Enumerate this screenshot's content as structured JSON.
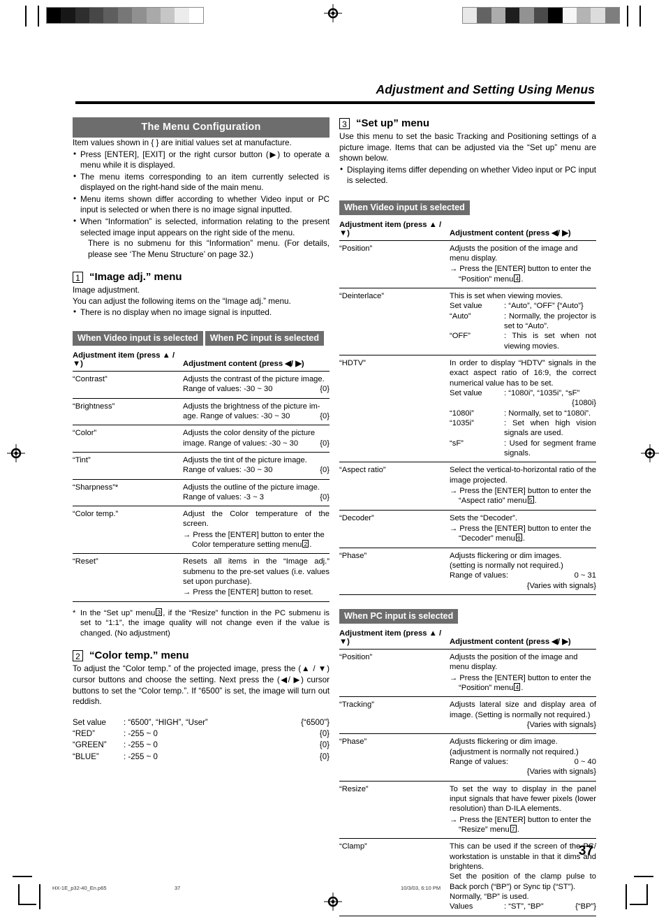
{
  "header": {
    "running_head": "Adjustment and Setting Using Menus"
  },
  "left_column": {
    "section_banner": "The Menu Configuration",
    "intro": "Item values shown in {  } are initial values set at manufacture.",
    "intro_bullets": [
      "Press [ENTER], [EXIT] or the right cursor button (▶) to operate a menu while it is displayed.",
      "The menu items corresponding to an item currently selected is displayed on the right-hand side of the main menu.",
      "Menu items shown differ according to whether Video input or PC input is selected or when there is no image signal inputted.",
      "When “Information” is selected, information relating to the present selected image input appears on the right side of the menu."
    ],
    "intro_note": "There is no submenu for this “Information” menu. (For details, please see ‘The Menu Structure’ on page 32.)",
    "menu1": {
      "number": "1",
      "title": "“Image adj.” menu",
      "line1": "Image adjustment.",
      "line2": "You can adjust the following items on the “Image adj.” menu.",
      "bullet": "There is no display when no image signal is inputted.",
      "mode_tabs": [
        "When Video input is selected",
        "When PC input is selected"
      ],
      "table_headers": {
        "item": "Adjustment item (press ▲ / ▼)",
        "content": "Adjustment content (press ◀/ ▶)"
      },
      "rows": [
        {
          "item": "“Contrast”",
          "lines": [
            "Adjusts the contrast of the picture image."
          ],
          "range_label": "Range of values: -30 ~ 30",
          "default": "{0}"
        },
        {
          "item": "“Brightness”",
          "lines": [
            "Adjusts the brightness of the picture im-"
          ],
          "range_label": "age. Range of values: -30 ~ 30",
          "default": "{0}"
        },
        {
          "item": "“Color”",
          "lines": [
            "Adjusts the color density of the picture"
          ],
          "range_label": "image. Range of values: -30 ~ 30",
          "default": "{0}"
        },
        {
          "item": "“Tint”",
          "lines": [
            "Adjusts the tint of the picture image."
          ],
          "range_label": "Range of values: -30 ~ 30",
          "default": "{0}"
        },
        {
          "item": "“Sharpness”*",
          "lines": [
            "Adjusts the outline of the picture image."
          ],
          "range_label": "Range of values: -3 ~ 3",
          "default": "{0}"
        },
        {
          "item": "“Color temp.”",
          "lines": [
            "Adjust the Color temperature of the screen."
          ],
          "arrow_text_a": "→ Press the [ENTER] button to enter the",
          "arrow_text_b": "Color temperature setting menu",
          "arrow_ref": "2",
          "arrow_tail": "."
        },
        {
          "item": "“Reset”",
          "lines": [
            "Resets all items in the “Image adj.” submenu to the pre-set values (i.e. values set upon purchase)."
          ],
          "arrow_text_a": "→ Press the [ENTER] button to reset."
        }
      ],
      "footnote_star": "*",
      "footnote_a": "In the “Set up” menu",
      "footnote_ref": "3",
      "footnote_b": ", if the “Resize” function in the PC submenu is set to “1:1”, the image quality will not change even if the value is changed. (No adjustment)"
    },
    "menu2": {
      "number": "2",
      "title": "“Color temp.” menu",
      "body": "To adjust the “Color temp.” of the projected image, press the (▲ / ▼) cursor buttons and choose the setting. Next press the (◀/ ▶) cursor buttons to set the “Color temp.”. If “6500” is set, the image will turn out reddish.",
      "values": [
        {
          "name": "Set value",
          "spec": ": “6500”, “HIGH”, “User”",
          "default": "{“6500”}"
        },
        {
          "name": "“RED”",
          "spec": ": -255 ~ 0",
          "default": "{0}"
        },
        {
          "name": "“GREEN”",
          "spec": ": -255 ~ 0",
          "default": "{0}"
        },
        {
          "name": "“BLUE”",
          "spec": ": -255 ~ 0",
          "default": "{0}"
        }
      ]
    }
  },
  "right_column": {
    "menu3": {
      "number": "3",
      "title": "“Set up” menu",
      "body": "Use this menu to set the basic Tracking and Positioning settings of a picture image. Items that can be adjusted via the “Set up” menu are shown below.",
      "bullet": "Displaying items differ depending on whether Video input or PC input is selected.",
      "video_tab": "When Video input is selected",
      "pc_tab": "When PC input is selected",
      "table_headers": {
        "item": "Adjustment item (press ▲ / ▼)",
        "content": "Adjustment content (press ◀/ ▶)"
      },
      "video_rows": [
        {
          "item": "“Position”",
          "line1": "Adjusts the position of the image and",
          "line2": "menu display.",
          "arrow1": "→ Press the [ENTER] button to enter the",
          "arrow2": "“Position” menu",
          "ref": "4",
          "tail": "."
        },
        {
          "item": "“Deinterlace”",
          "line1": "This is set when viewing movies.",
          "pairs": [
            {
              "k": "Set value",
              "v": ": “Auto”, “OFF”   {“Auto”}"
            },
            {
              "k": "“Auto”",
              "v": ": Normally, the projector is set to “Auto”."
            },
            {
              "k": "“OFF”",
              "v": ": This is set when not viewing movies."
            }
          ]
        },
        {
          "item": "“HDTV”",
          "line1": "In order to display “HDTV” signals in the exact aspect ratio of 16:9, the correct numerical value has to be set.",
          "pairs": [
            {
              "k": "Set value",
              "v": ": “1080i”, “1035i”, “sF”",
              "right": "{1080i}"
            },
            {
              "k": "“1080i”",
              "v": ": Normally, set to “1080i”."
            },
            {
              "k": "“1035i”",
              "v": ": Set when high vision signals are used."
            },
            {
              "k": "“sF”",
              "v": ": Used for segment frame signals."
            }
          ]
        },
        {
          "item": "“Aspect ratio”",
          "line1": "Select the vertical-to-horizontal ratio of the image projected.",
          "arrow1": "→ Press the [ENTER] button to enter the",
          "arrow2": "“Aspect ratio” menu",
          "ref": "5",
          "tail": "."
        },
        {
          "item": "“Decoder”",
          "line1": "Sets the “Decoder”.",
          "arrow1": "→ Press the [ENTER] button to enter the",
          "arrow2": "“Decoder” menu",
          "ref": "6",
          "tail": "."
        },
        {
          "item": "“Phase”",
          "line1": "Adjusts flickering or dim images.",
          "line2": "(setting is normally not required.)",
          "range_label": "Range of values:",
          "range_value": "0 ~ 31",
          "default": "{Varies with signals}"
        }
      ],
      "pc_rows": [
        {
          "item": "“Position”",
          "line1": "Adjusts the position of the image and",
          "line2": "menu display.",
          "arrow1": "→ Press the [ENTER] button to enter the",
          "arrow2": "“Position” menu",
          "ref": "4",
          "tail": "."
        },
        {
          "item": "“Tracking”",
          "line1": "Adjusts lateral size and display area of image. (Setting is normally not required.)",
          "default": "{Varies with signals}"
        },
        {
          "item": "“Phase”",
          "line1": "Adjusts flickering or dim image.",
          "line2": "(adjustment is normally not required.)",
          "range_label": "Range of values:",
          "range_value": "0 ~ 40",
          "default": "{Varies with signals}"
        },
        {
          "item": "“Resize”",
          "line1": "To set the way to display in the panel input signals that have fewer pixels (lower resolution) than D-ILA elements.",
          "arrow1": "→ Press the [ENTER] button to enter the",
          "arrow2": "“Resize” menu",
          "ref": "7",
          "tail": "."
        },
        {
          "item": "“Clamp”",
          "line1": "This can be used if the screen of the PC/ workstation is unstable in that it dims and brightens.",
          "line2": "Set the position of the clamp pulse to Back porch (“BP”) or Sync tip (“ST”).",
          "line3": "Normally, “BP” is used.",
          "values_label": "Values",
          "values_spec": ": “ST”, “BP”",
          "values_default": "{“BP”}"
        }
      ]
    }
  },
  "footer": {
    "page_number": "37",
    "print_file": "HX-1E_p32-40_En.p65",
    "print_page": "37",
    "print_date": "10/3/03, 6:10 PM"
  },
  "colors": {
    "banner_grey": "#6d6d6d",
    "rule_black": "#000000"
  },
  "calibration": {
    "left_bar_steps": [
      "#000000",
      "#171717",
      "#2e2e2e",
      "#474747",
      "#5e5e5e",
      "#777777",
      "#909090",
      "#a9a9a9",
      "#c6c6c6",
      "#ececec",
      "#ffffff"
    ],
    "right_bar_steps": [
      "#e8e8e8",
      "#636363",
      "#acacac",
      "#1e1e1e",
      "#929292",
      "#4a4a4a",
      "#000000",
      "#f6f6f6",
      "#b4b4b4",
      "#dcdcdc",
      "#7e7e7e"
    ]
  }
}
